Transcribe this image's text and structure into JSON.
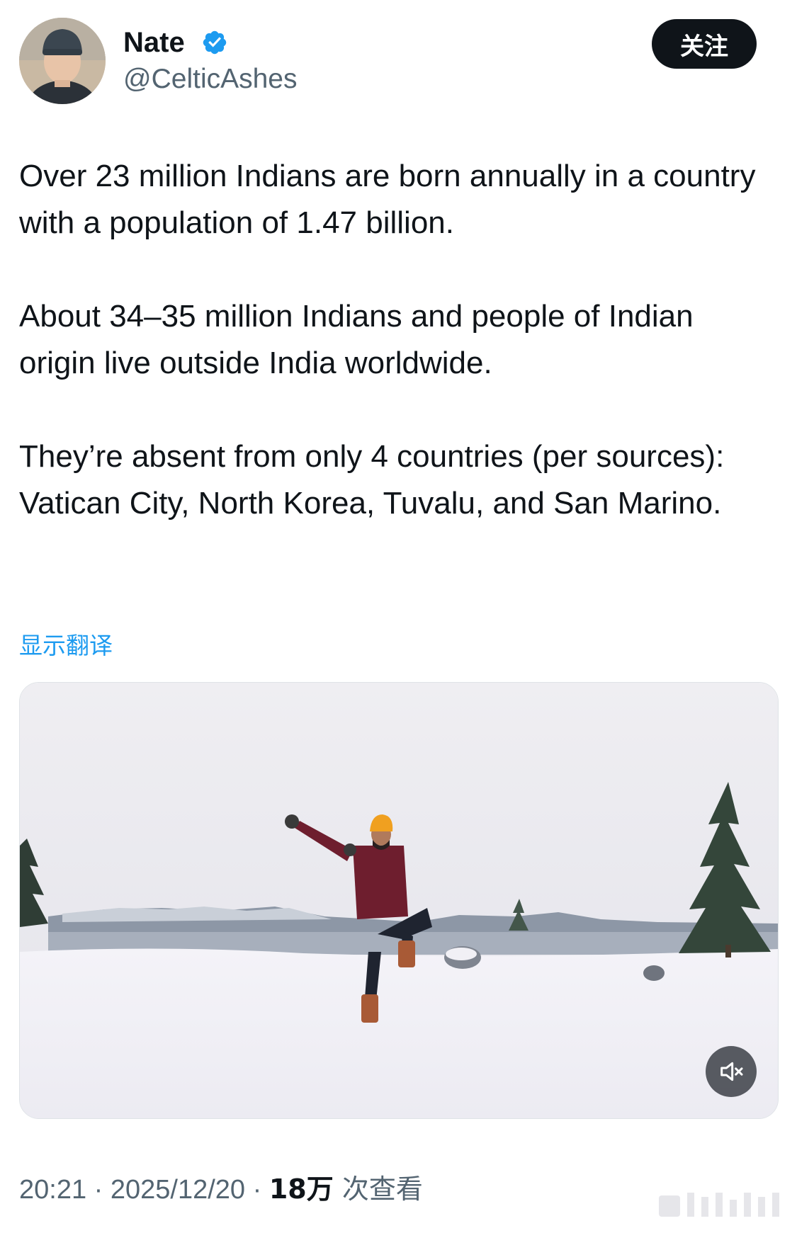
{
  "author": {
    "display_name": "Nate",
    "handle": "@CelticAshes",
    "verified_icon": "verified-badge-icon",
    "avatar_icon": "profile-avatar"
  },
  "follow_button": {
    "label": "关注"
  },
  "tweet": {
    "paragraphs": [
      "Over 23 million Indians are born annually in a country with a population of 1.47 billion.",
      "About 34–35 million Indians and people of Indian origin live outside India worldwide.",
      "They’re absent from only 4 countries (per sources): Vatican City, North Korea, Tuvalu, and San Marino."
    ],
    "translate_label": "显示翻译"
  },
  "media": {
    "type": "video",
    "description_icon": "video-thumbnail",
    "mute_icon": "speaker-muted-icon"
  },
  "meta": {
    "time": "20:21",
    "separator": " · ",
    "date": "2025/12/20",
    "views_count": "18万",
    "views_label": " 次查看"
  },
  "colors": {
    "text": "#0f1419",
    "secondary": "#536471",
    "link": "#1d9bf0",
    "verified": "#1d9bf0",
    "button_bg": "#0f1419"
  }
}
